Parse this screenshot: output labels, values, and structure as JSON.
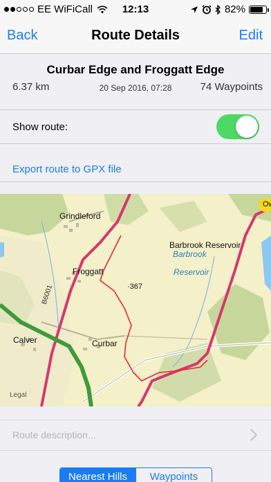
{
  "status_bar": {
    "carrier": "EE WiFiCall",
    "time": "12:13",
    "battery_percent": "82%",
    "battery_level": 0.82,
    "signal_bars_filled": 2,
    "signal_bars_total": 5,
    "icons": [
      "wifi-icon",
      "location-arrow-icon",
      "alarm-icon",
      "bluetooth-icon",
      "battery-icon"
    ]
  },
  "nav": {
    "back_label": "Back",
    "title": "Route Details",
    "edit_label": "Edit"
  },
  "route": {
    "name": "Curbar Edge and Froggatt Edge",
    "distance": "6.37 km",
    "date": "20 Sep 2016, 07:28",
    "waypoints": "74 Waypoints"
  },
  "show_route": {
    "label": "Show route:",
    "enabled": true
  },
  "export": {
    "label": "Export route to GPX file"
  },
  "map": {
    "labels": {
      "grindleford": "Grindleford",
      "froggatt": "Froggatt",
      "calver": "Calver",
      "curbar": "Curbar",
      "spot_height": "367",
      "barbrook_reservoir": "Barbrook Reservoir",
      "barbrook_water": "Barbrook",
      "reservoir_water": "Reservoir",
      "road_b6001": "B6001",
      "legal": "Legal",
      "ow": "Ow"
    },
    "colors": {
      "land": "#f4f0c9",
      "woodland": "#c7d79c",
      "route": "#e8283c",
      "major_road": "#d6386e",
      "a_road": "#3f9b3a",
      "water": "#8ec7ef"
    }
  },
  "description": {
    "placeholder": "Route description..."
  },
  "tabs": [
    {
      "label": "Nearest Hills",
      "active": true
    },
    {
      "label": "Waypoints",
      "active": false
    }
  ]
}
